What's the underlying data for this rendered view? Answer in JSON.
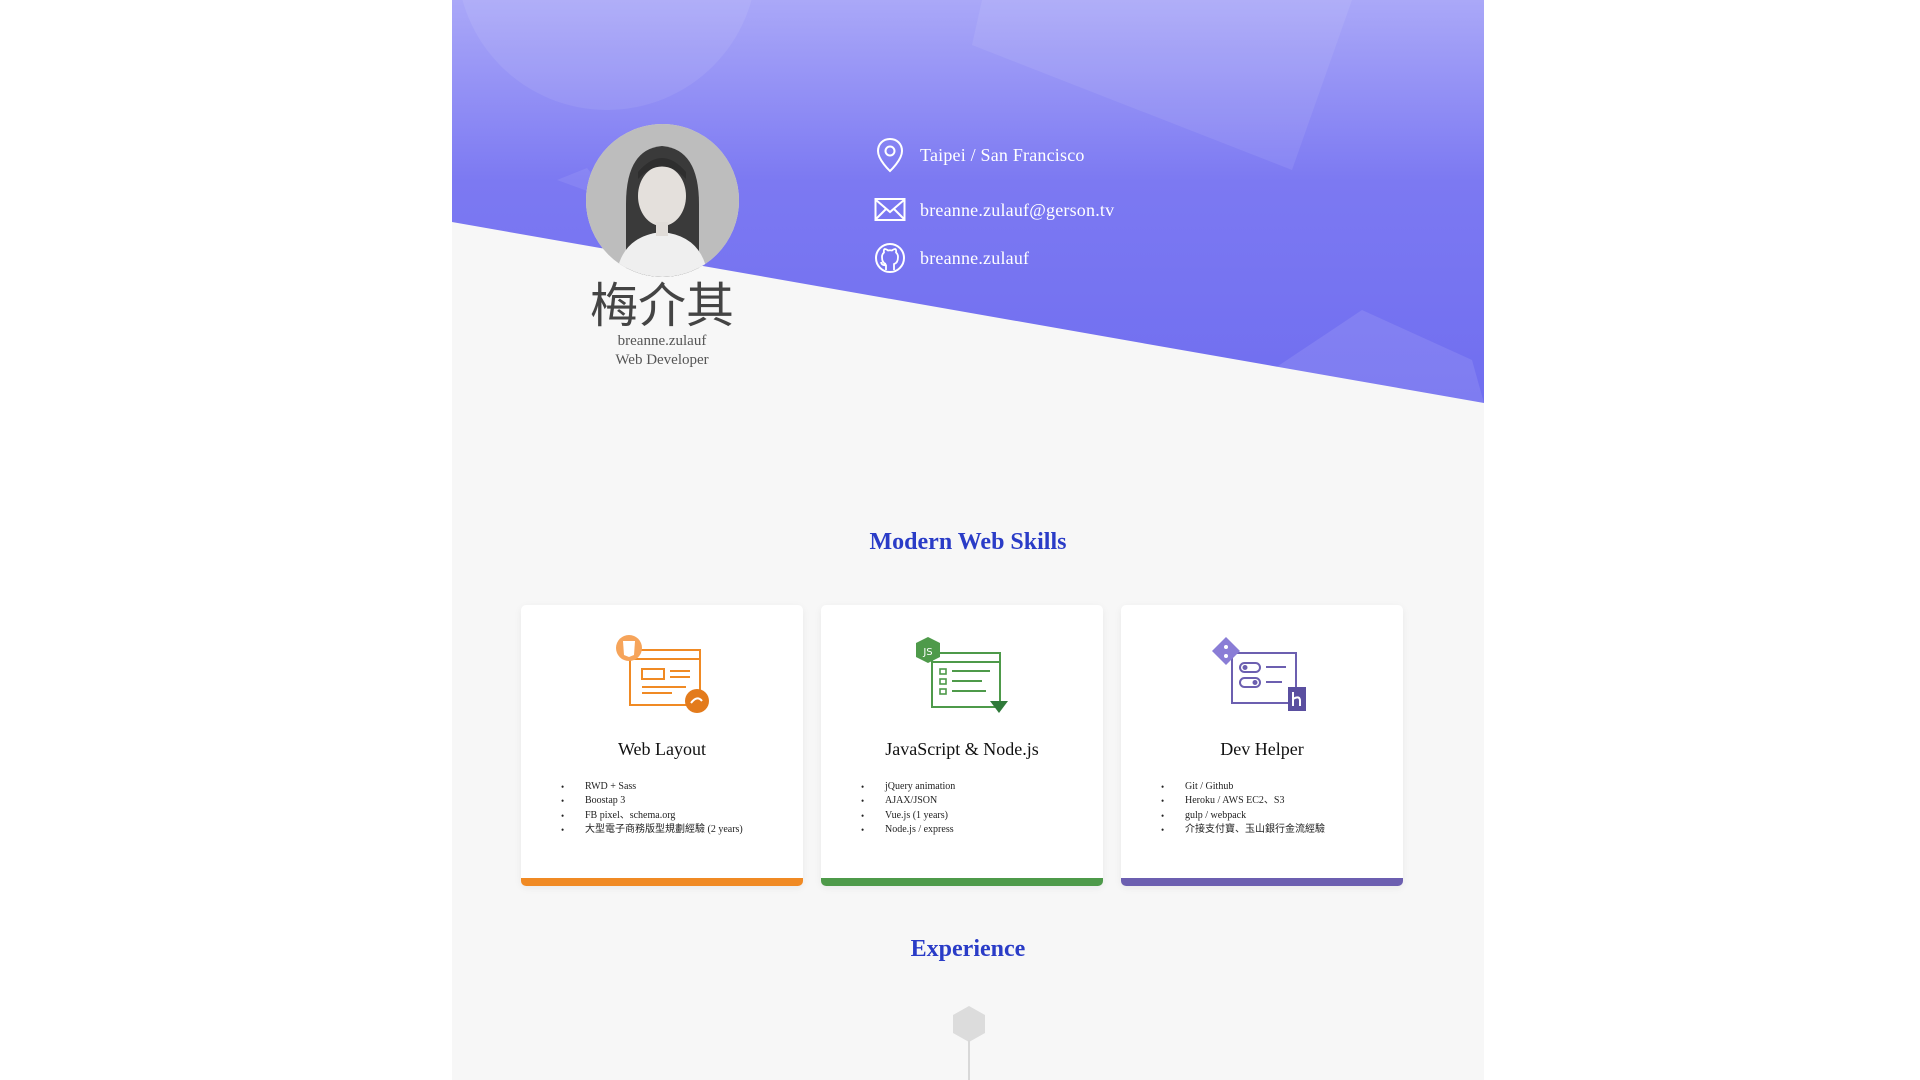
{
  "profile": {
    "name": "梅介其",
    "handle": "breanne.zulauf",
    "title": "Web Developer"
  },
  "contacts": {
    "location": "Taipei / San Francisco",
    "email": "breanne.zulauf@gerson.tv",
    "github": "breanne.zulauf"
  },
  "sections": {
    "skills_title": "Modern Web Skills",
    "experience_title": "Experience"
  },
  "skills": [
    {
      "title": "Web Layout",
      "color": "#f08a24",
      "icon": "html5-sass-layout-icon",
      "items": [
        "RWD + Sass",
        "Boostap 3",
        "FB pixel、schema.org",
        "大型電子商務版型規劃經驗 (2 years)"
      ]
    },
    {
      "title": "JavaScript & Node.js",
      "color": "#4e9a4a",
      "icon": "nodejs-code-icon",
      "items": [
        "jQuery animation",
        "AJAX/JSON",
        "Vue.js (1 years)",
        "Node.js / express"
      ]
    },
    {
      "title": "Dev Helper",
      "color": "#6c5fb0",
      "icon": "git-toggle-heroku-icon",
      "items": [
        "Git / Github",
        "Heroku / AWS EC2、S3",
        "gulp / webpack",
        "介接支付寶、玉山銀行金流經驗"
      ]
    }
  ],
  "colors": {
    "hero_top": "#a9a6f7",
    "hero_bottom": "#6f6ef0",
    "section_title": "#2a3cc7",
    "page_bg": "#f7f7f7"
  }
}
